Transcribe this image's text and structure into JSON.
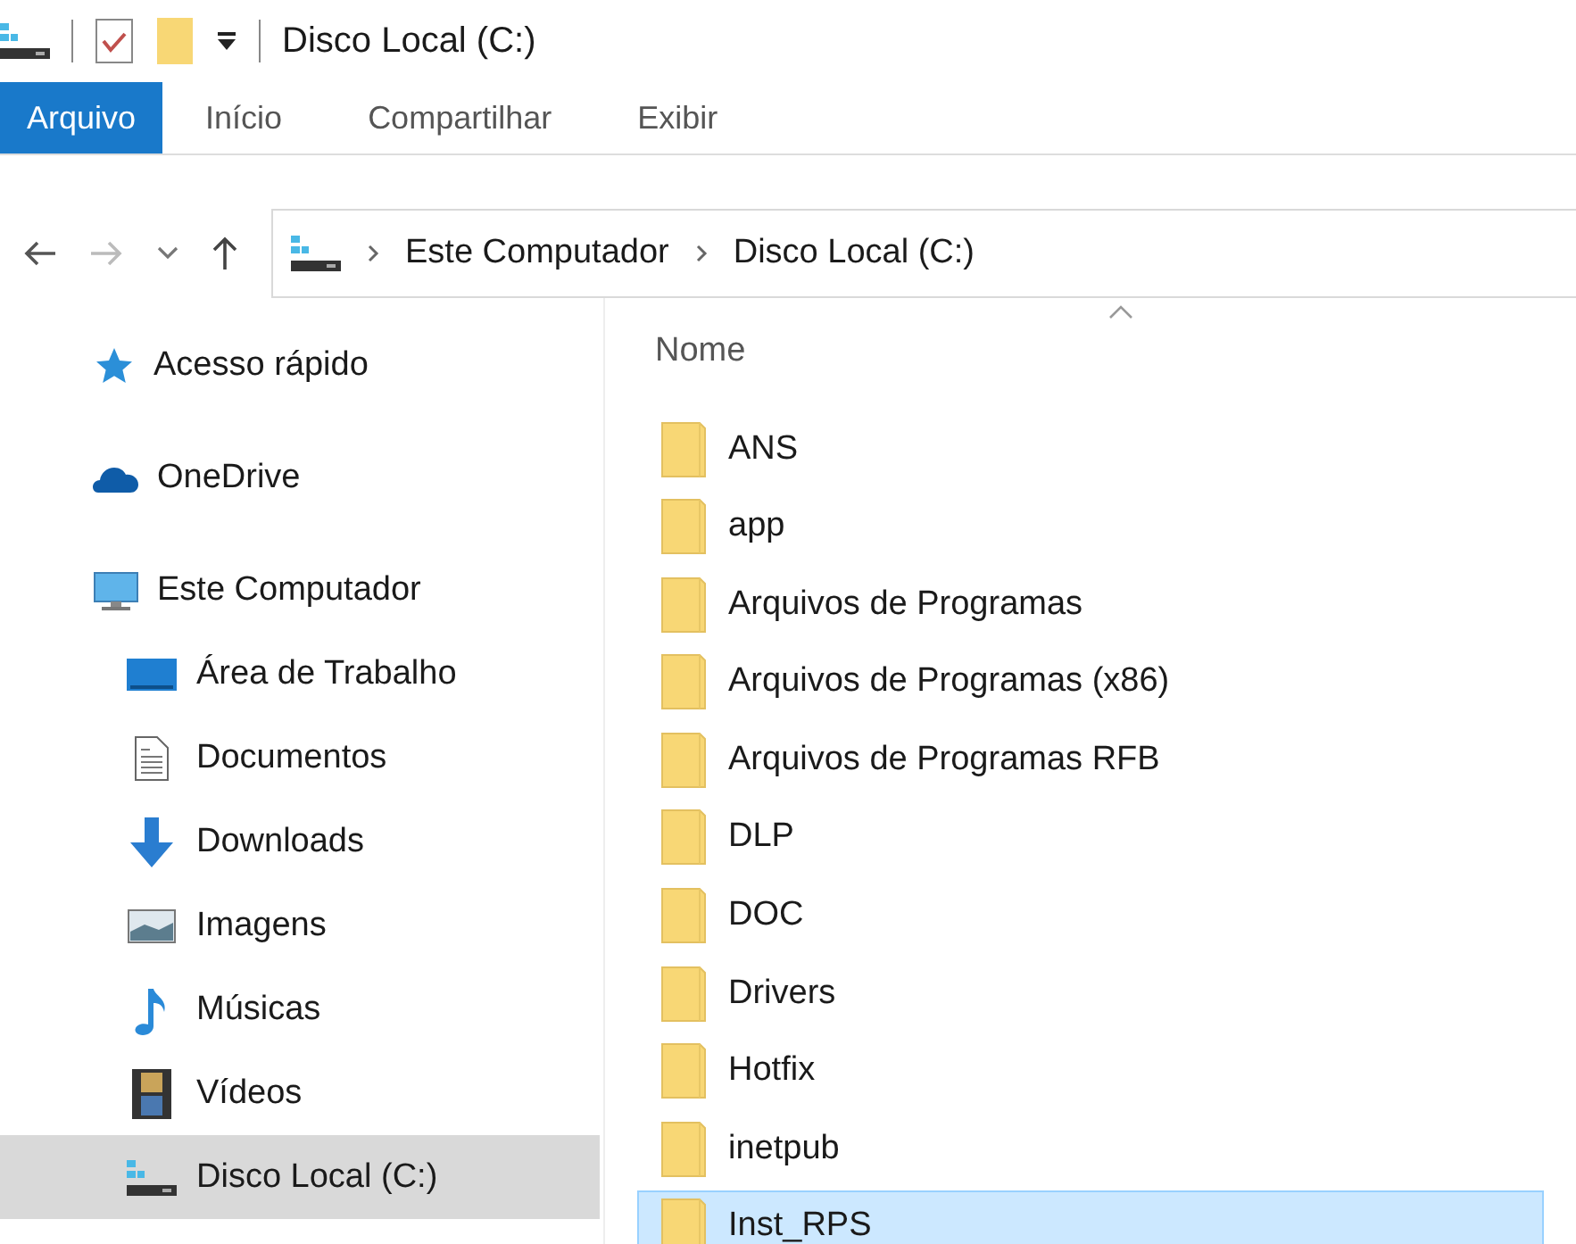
{
  "window": {
    "title": "Disco Local (C:)"
  },
  "ribbon_tabs": [
    {
      "label": "Arquivo",
      "selected": true
    },
    {
      "label": "Início",
      "selected": false
    },
    {
      "label": "Compartilhar",
      "selected": false
    },
    {
      "label": "Exibir",
      "selected": false
    }
  ],
  "navigation": {
    "back": {
      "disabled": false
    },
    "forward": {
      "disabled": true
    }
  },
  "breadcrumb": [
    "Este Computador",
    "Disco Local (C:)"
  ],
  "sidebar": {
    "items": [
      {
        "label": "Acesso rápido",
        "selected": false
      },
      {
        "label": "OneDrive",
        "selected": false
      },
      {
        "label": "Este Computador",
        "selected": false,
        "children": [
          {
            "label": "Área de Trabalho",
            "selected": false
          },
          {
            "label": "Documentos",
            "selected": false
          },
          {
            "label": "Downloads",
            "selected": false
          },
          {
            "label": "Imagens",
            "selected": false
          },
          {
            "label": "Músicas",
            "selected": false
          },
          {
            "label": "Vídeos",
            "selected": false
          },
          {
            "label": "Disco Local (C:)",
            "selected": true
          }
        ]
      }
    ]
  },
  "file_list": {
    "columns": [
      "Nome"
    ],
    "rows": [
      {
        "name": "ANS",
        "selected": false
      },
      {
        "name": "app",
        "selected": false
      },
      {
        "name": "Arquivos de Programas",
        "selected": false
      },
      {
        "name": "Arquivos de Programas (x86)",
        "selected": false
      },
      {
        "name": "Arquivos de Programas RFB",
        "selected": false
      },
      {
        "name": "DLP",
        "selected": false
      },
      {
        "name": "DOC",
        "selected": false
      },
      {
        "name": "Drivers",
        "selected": false
      },
      {
        "name": "Hotfix",
        "selected": false
      },
      {
        "name": "inetpub",
        "selected": false
      },
      {
        "name": "Inst_RPS",
        "selected": true
      }
    ]
  }
}
